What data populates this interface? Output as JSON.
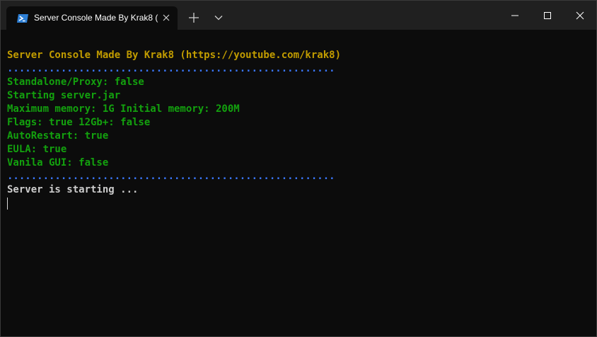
{
  "window": {
    "tab_title": "Server Console Made By Krak8 (",
    "tab_icon": "powershell-icon",
    "new_tab_icon": "plus-icon",
    "dropdown_icon": "chevron-down-icon",
    "minimize_icon": "minimize-icon",
    "maximize_icon": "maximize-icon",
    "close_icon": "close-icon"
  },
  "terminal": {
    "colors": {
      "header": "#c19c00",
      "separator": "#3b78ff",
      "info": "#13a10e",
      "status": "#cccccc",
      "background": "#0c0c0c"
    },
    "lines": {
      "header": "Server Console Made By Krak8 (https://youtube.com/krak8)",
      "separator_top": ".......................................................",
      "standalone": "Standalone/Proxy: false",
      "starting": "Starting server.jar",
      "memory": "Maximum memory: 1G Initial memory: 200M",
      "flags": "Flags: true 12Gb+: false",
      "autorestart": "AutoRestart: true",
      "eula": "EULA: true",
      "vanila_gui": "Vanila GUI: false",
      "separator_bottom": ".......................................................",
      "status": "Server is starting ..."
    }
  }
}
